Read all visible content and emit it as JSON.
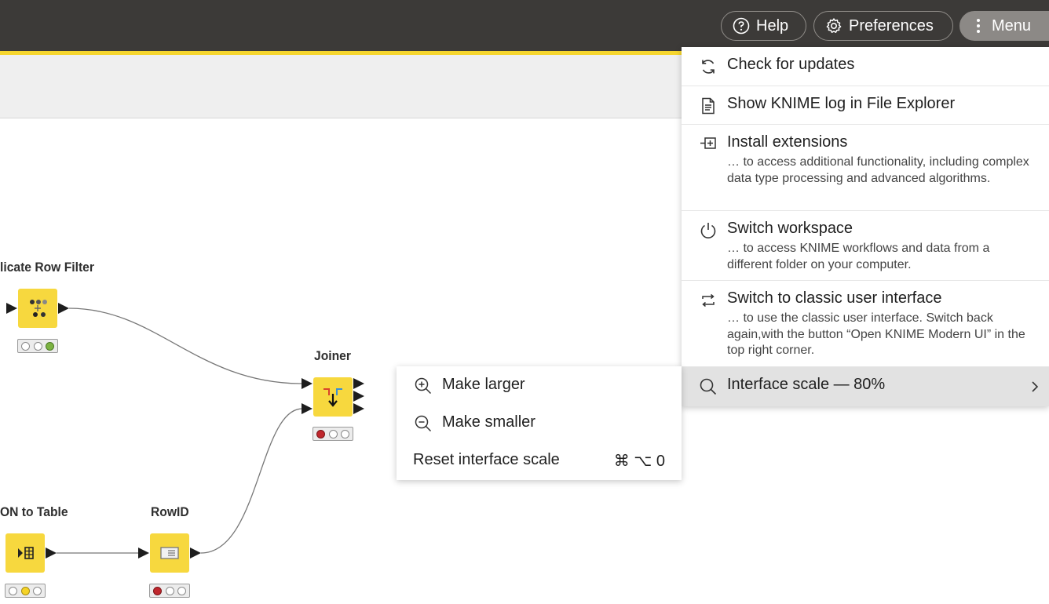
{
  "topbar": {
    "help_label": "Help",
    "preferences_label": "Preferences",
    "menu_label": "Menu"
  },
  "workflow": {
    "nodes": [
      {
        "label": "licate Row Filter",
        "status": [
          "off",
          "off",
          "green"
        ]
      },
      {
        "label": "Joiner",
        "status": [
          "red",
          "off",
          "off"
        ]
      },
      {
        "label": "ON to Table",
        "status": [
          "off",
          "yellow",
          "off"
        ]
      },
      {
        "label": "RowID",
        "status": [
          "red",
          "off",
          "off"
        ]
      }
    ]
  },
  "menu": {
    "items": [
      {
        "icon": "refresh-icon",
        "title": "Check for updates"
      },
      {
        "icon": "document-icon",
        "title": "Show KNIME log in File Explorer"
      },
      {
        "icon": "install-extension-icon",
        "title": "Install extensions",
        "description": "… to access additional functionality, including complex data type processing and advanced algorithms."
      },
      {
        "icon": "power-icon",
        "title": "Switch workspace",
        "description": "… to access KNIME workflows and data from a different folder on your computer."
      },
      {
        "icon": "switch-ui-icon",
        "title": "Switch to classic user interface",
        "description": "… to use the classic user interface. Switch back again,with the button “Open KNIME Modern UI” in the top right corner."
      },
      {
        "icon": "search-icon",
        "title": "Interface scale — 80%"
      }
    ]
  },
  "submenu": {
    "items": [
      {
        "icon": "zoom-in-icon",
        "label": "Make larger"
      },
      {
        "icon": "zoom-out-icon",
        "label": "Make smaller"
      },
      {
        "label": "Reset interface scale",
        "shortcut": "⌘ ⌥ 0"
      }
    ]
  },
  "colors": {
    "topbar": "#3c3a38",
    "accent_yellow": "#f6d62e",
    "node_yellow": "#f7d83e",
    "status_red": "#c0272d",
    "status_green": "#7cb342",
    "status_yellow": "#f5d327"
  }
}
